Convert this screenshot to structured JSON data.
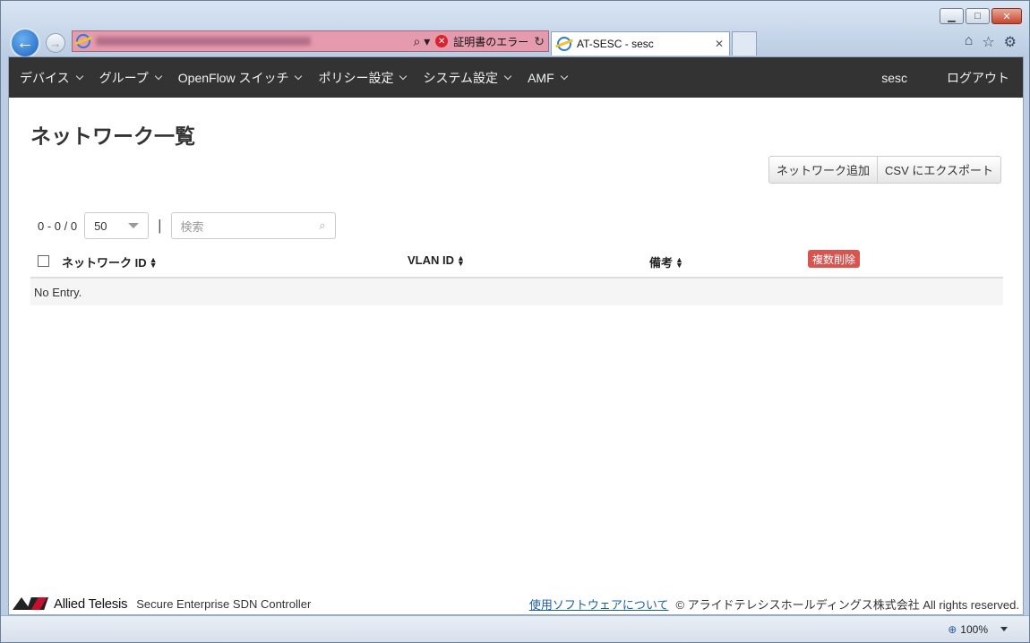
{
  "browser": {
    "cert_error": "証明書のエラー",
    "tab_title": "AT-SESC - sesc",
    "zoom": "100%"
  },
  "nav": {
    "items": [
      {
        "label": "デバイス"
      },
      {
        "label": "グループ"
      },
      {
        "label": "OpenFlow スイッチ"
      },
      {
        "label": "ポリシー設定"
      },
      {
        "label": "システム設定"
      },
      {
        "label": "AMF"
      }
    ],
    "user": "sesc",
    "logout": "ログアウト"
  },
  "page": {
    "title": "ネットワーク一覧",
    "add_button": "ネットワーク追加",
    "export_button": "CSV にエクスポート"
  },
  "pager": {
    "count": "0 - 0 / 0",
    "page_size": "50",
    "search_placeholder": "検索"
  },
  "table": {
    "columns": [
      "ネットワーク ID",
      "VLAN ID",
      "備考"
    ],
    "bulk_delete": "複数削除",
    "empty": "No Entry."
  },
  "footer": {
    "brand": "Allied Telesis",
    "product": "Secure Enterprise SDN Controller",
    "about_link": "使用ソフトウェアについて",
    "copyright": "© アライドテレシスホールディングス株式会社 All rights reserved."
  }
}
